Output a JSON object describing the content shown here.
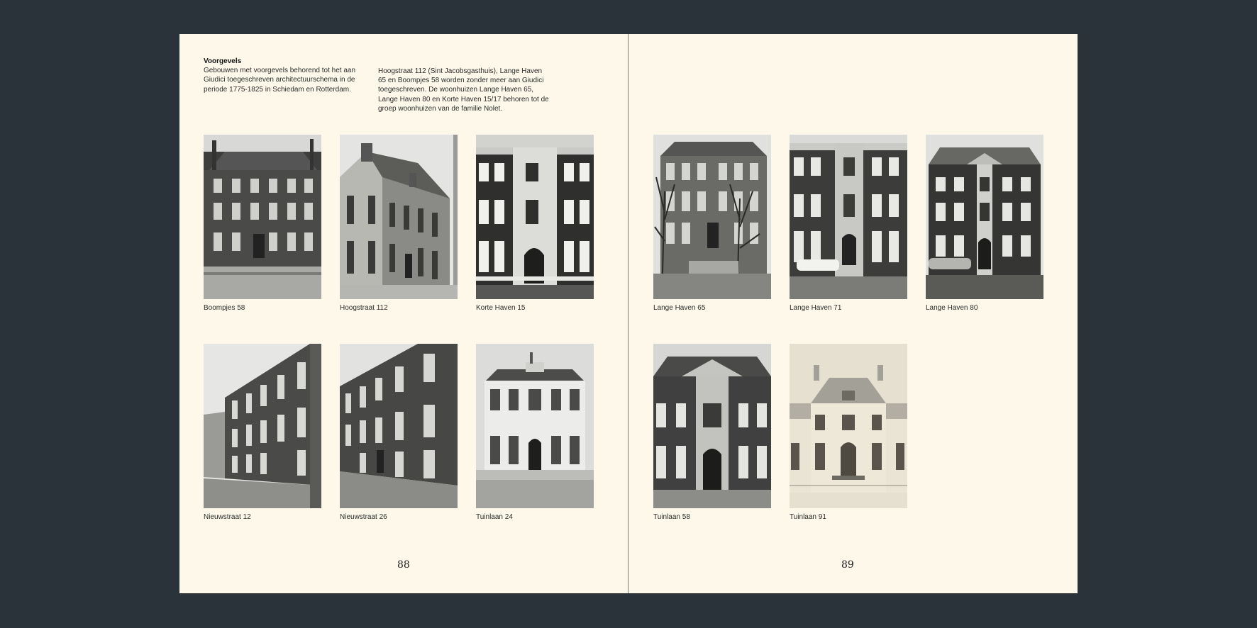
{
  "left_page": {
    "intro_title": "Voorgevels",
    "intro_text": "Gebouwen met voorgevels behorend tot het aan Giudici toegeschreven architectuurschema in de periode 1775-1825 in Schiedam en Rotterdam.",
    "intro_text_2": "Hoogstraat 112 (Sint Jacobsgasthuis), Lange Haven 65 en Boompjes 58 worden zonder meer aan Giudici toegeschreven. De woonhuizen Lange Haven 65, Lange Haven 80 en Korte Haven 15/17 behoren tot de groep woonhuizen van de familie Nolet.",
    "photos": [
      {
        "caption": "Boompjes 58"
      },
      {
        "caption": "Hoogstraat 112"
      },
      {
        "caption": "Korte Haven 15"
      },
      {
        "caption": "Nieuwstraat 12"
      },
      {
        "caption": "Nieuwstraat 26"
      },
      {
        "caption": "Tuinlaan 24"
      }
    ],
    "page_number": "88"
  },
  "right_page": {
    "photos": [
      {
        "caption": "Lange Haven 65"
      },
      {
        "caption": "Lange Haven 71"
      },
      {
        "caption": "Lange Haven 80"
      },
      {
        "caption": "Tuinlaan 58"
      },
      {
        "caption": "Tuinlaan 91"
      }
    ],
    "page_number": "89"
  },
  "colors": {
    "background": "#2a333a",
    "paper": "#fdf8ea",
    "text": "#1e1e1e"
  }
}
